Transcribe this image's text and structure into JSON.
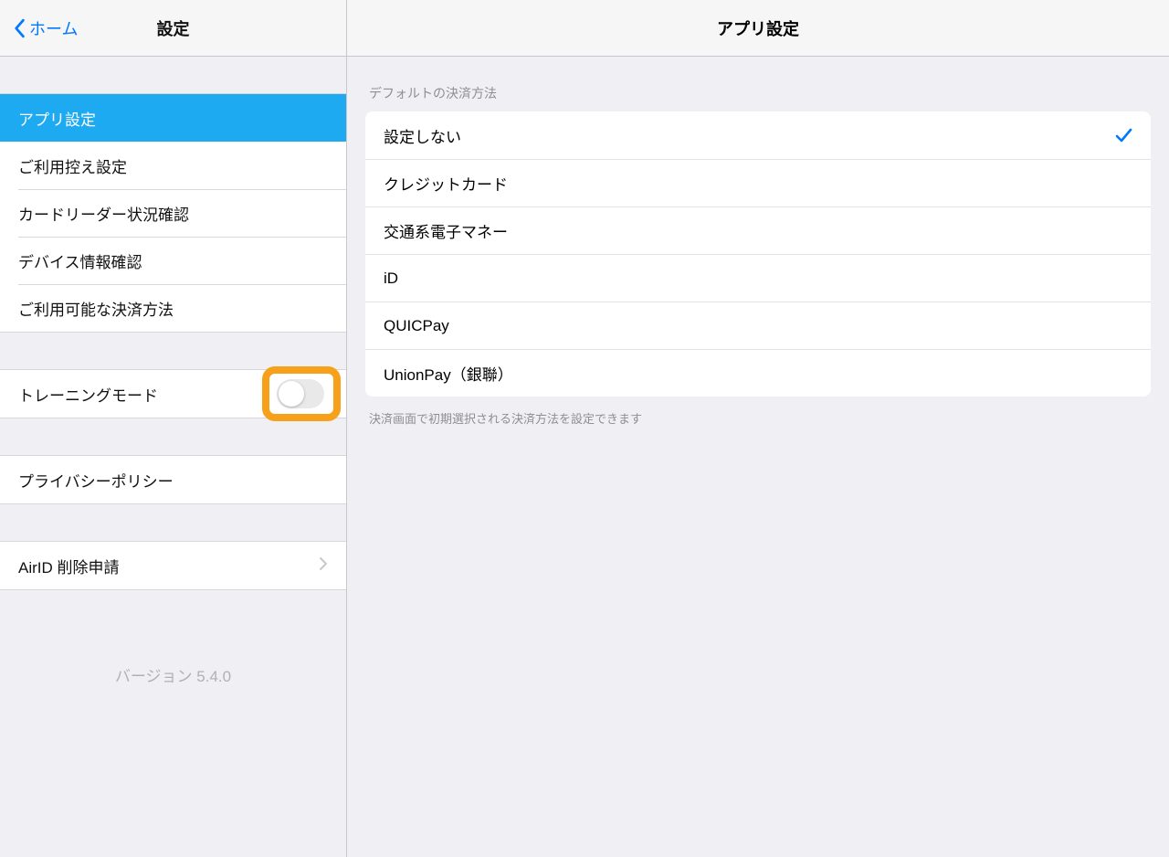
{
  "sidebar": {
    "back_label": "ホーム",
    "title": "設定",
    "group1": [
      {
        "label": "アプリ設定",
        "selected": true
      },
      {
        "label": "ご利用控え設定"
      },
      {
        "label": "カードリーダー状況確認"
      },
      {
        "label": "デバイス情報確認"
      },
      {
        "label": "ご利用可能な決済方法"
      }
    ],
    "group2": [
      {
        "label": "トレーニングモード",
        "type": "switch",
        "on": false,
        "highlighted": true
      }
    ],
    "group3": [
      {
        "label": "プライバシーポリシー"
      }
    ],
    "group4": [
      {
        "label": "AirID 削除申請",
        "chevron": true
      }
    ],
    "version": "バージョン 5.4.0"
  },
  "detail": {
    "title": "アプリ設定",
    "section_header": "デフォルトの決済方法",
    "options": [
      {
        "label": "設定しない",
        "selected": true
      },
      {
        "label": "クレジットカード"
      },
      {
        "label": "交通系電子マネー"
      },
      {
        "label": "iD"
      },
      {
        "label": "QUICPay"
      },
      {
        "label": "UnionPay（銀聯）"
      }
    ],
    "section_footer": "決済画面で初期選択される決済方法を設定できます"
  }
}
